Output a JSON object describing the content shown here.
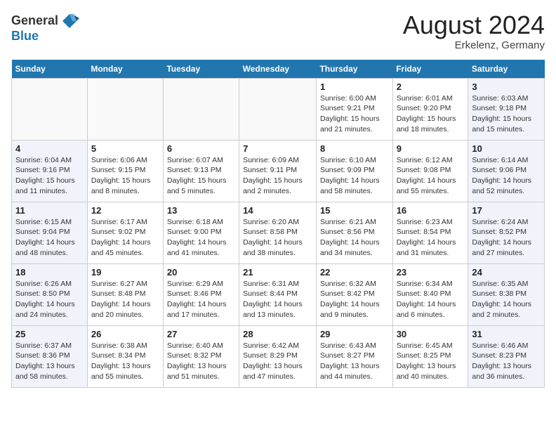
{
  "header": {
    "logo_general": "General",
    "logo_blue": "Blue",
    "title": "August 2024",
    "subtitle": "Erkelenz, Germany"
  },
  "days_of_week": [
    "Sunday",
    "Monday",
    "Tuesday",
    "Wednesday",
    "Thursday",
    "Friday",
    "Saturday"
  ],
  "weeks": [
    [
      {
        "day": "",
        "info": ""
      },
      {
        "day": "",
        "info": ""
      },
      {
        "day": "",
        "info": ""
      },
      {
        "day": "",
        "info": ""
      },
      {
        "day": "1",
        "info": "Sunrise: 6:00 AM\nSunset: 9:21 PM\nDaylight: 15 hours\nand 21 minutes."
      },
      {
        "day": "2",
        "info": "Sunrise: 6:01 AM\nSunset: 9:20 PM\nDaylight: 15 hours\nand 18 minutes."
      },
      {
        "day": "3",
        "info": "Sunrise: 6:03 AM\nSunset: 9:18 PM\nDaylight: 15 hours\nand 15 minutes."
      }
    ],
    [
      {
        "day": "4",
        "info": "Sunrise: 6:04 AM\nSunset: 9:16 PM\nDaylight: 15 hours\nand 11 minutes."
      },
      {
        "day": "5",
        "info": "Sunrise: 6:06 AM\nSunset: 9:15 PM\nDaylight: 15 hours\nand 8 minutes."
      },
      {
        "day": "6",
        "info": "Sunrise: 6:07 AM\nSunset: 9:13 PM\nDaylight: 15 hours\nand 5 minutes."
      },
      {
        "day": "7",
        "info": "Sunrise: 6:09 AM\nSunset: 9:11 PM\nDaylight: 15 hours\nand 2 minutes."
      },
      {
        "day": "8",
        "info": "Sunrise: 6:10 AM\nSunset: 9:09 PM\nDaylight: 14 hours\nand 58 minutes."
      },
      {
        "day": "9",
        "info": "Sunrise: 6:12 AM\nSunset: 9:08 PM\nDaylight: 14 hours\nand 55 minutes."
      },
      {
        "day": "10",
        "info": "Sunrise: 6:14 AM\nSunset: 9:06 PM\nDaylight: 14 hours\nand 52 minutes."
      }
    ],
    [
      {
        "day": "11",
        "info": "Sunrise: 6:15 AM\nSunset: 9:04 PM\nDaylight: 14 hours\nand 48 minutes."
      },
      {
        "day": "12",
        "info": "Sunrise: 6:17 AM\nSunset: 9:02 PM\nDaylight: 14 hours\nand 45 minutes."
      },
      {
        "day": "13",
        "info": "Sunrise: 6:18 AM\nSunset: 9:00 PM\nDaylight: 14 hours\nand 41 minutes."
      },
      {
        "day": "14",
        "info": "Sunrise: 6:20 AM\nSunset: 8:58 PM\nDaylight: 14 hours\nand 38 minutes."
      },
      {
        "day": "15",
        "info": "Sunrise: 6:21 AM\nSunset: 8:56 PM\nDaylight: 14 hours\nand 34 minutes."
      },
      {
        "day": "16",
        "info": "Sunrise: 6:23 AM\nSunset: 8:54 PM\nDaylight: 14 hours\nand 31 minutes."
      },
      {
        "day": "17",
        "info": "Sunrise: 6:24 AM\nSunset: 8:52 PM\nDaylight: 14 hours\nand 27 minutes."
      }
    ],
    [
      {
        "day": "18",
        "info": "Sunrise: 6:26 AM\nSunset: 8:50 PM\nDaylight: 14 hours\nand 24 minutes."
      },
      {
        "day": "19",
        "info": "Sunrise: 6:27 AM\nSunset: 8:48 PM\nDaylight: 14 hours\nand 20 minutes."
      },
      {
        "day": "20",
        "info": "Sunrise: 6:29 AM\nSunset: 8:46 PM\nDaylight: 14 hours\nand 17 minutes."
      },
      {
        "day": "21",
        "info": "Sunrise: 6:31 AM\nSunset: 8:44 PM\nDaylight: 14 hours\nand 13 minutes."
      },
      {
        "day": "22",
        "info": "Sunrise: 6:32 AM\nSunset: 8:42 PM\nDaylight: 14 hours\nand 9 minutes."
      },
      {
        "day": "23",
        "info": "Sunrise: 6:34 AM\nSunset: 8:40 PM\nDaylight: 14 hours\nand 6 minutes."
      },
      {
        "day": "24",
        "info": "Sunrise: 6:35 AM\nSunset: 8:38 PM\nDaylight: 14 hours\nand 2 minutes."
      }
    ],
    [
      {
        "day": "25",
        "info": "Sunrise: 6:37 AM\nSunset: 8:36 PM\nDaylight: 13 hours\nand 58 minutes."
      },
      {
        "day": "26",
        "info": "Sunrise: 6:38 AM\nSunset: 8:34 PM\nDaylight: 13 hours\nand 55 minutes."
      },
      {
        "day": "27",
        "info": "Sunrise: 6:40 AM\nSunset: 8:32 PM\nDaylight: 13 hours\nand 51 minutes."
      },
      {
        "day": "28",
        "info": "Sunrise: 6:42 AM\nSunset: 8:29 PM\nDaylight: 13 hours\nand 47 minutes."
      },
      {
        "day": "29",
        "info": "Sunrise: 6:43 AM\nSunset: 8:27 PM\nDaylight: 13 hours\nand 44 minutes."
      },
      {
        "day": "30",
        "info": "Sunrise: 6:45 AM\nSunset: 8:25 PM\nDaylight: 13 hours\nand 40 minutes."
      },
      {
        "day": "31",
        "info": "Sunrise: 6:46 AM\nSunset: 8:23 PM\nDaylight: 13 hours\nand 36 minutes."
      }
    ]
  ]
}
